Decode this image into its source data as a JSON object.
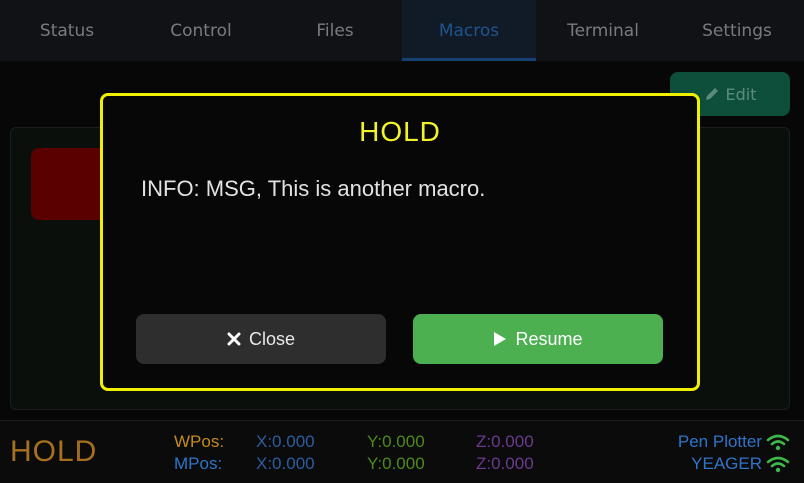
{
  "tabs": [
    {
      "label": "Status"
    },
    {
      "label": "Control"
    },
    {
      "label": "Files"
    },
    {
      "label": "Macros",
      "active": true
    },
    {
      "label": "Terminal"
    },
    {
      "label": "Settings"
    }
  ],
  "macros": {
    "edit_label": "Edit",
    "edit_icon": "pencil-icon"
  },
  "modal": {
    "title": "HOLD",
    "message": "INFO: MSG, This is another macro.",
    "close_label": "Close",
    "close_icon": "x-icon",
    "resume_label": "Resume",
    "resume_icon": "play-icon",
    "border_color": "#f0f000"
  },
  "status": {
    "state": "HOLD",
    "wpos_label": "WPos:",
    "mpos_label": "MPos:",
    "wpos": {
      "x": "X:0.000",
      "y": "Y:0.000",
      "z": "Z:0.000"
    },
    "mpos": {
      "x": "X:0.000",
      "y": "Y:0.000",
      "z": "Z:0.000"
    },
    "machine_name": "Pen Plotter",
    "network_name": "YEAGER",
    "wifi_icon": "wifi-icon"
  }
}
